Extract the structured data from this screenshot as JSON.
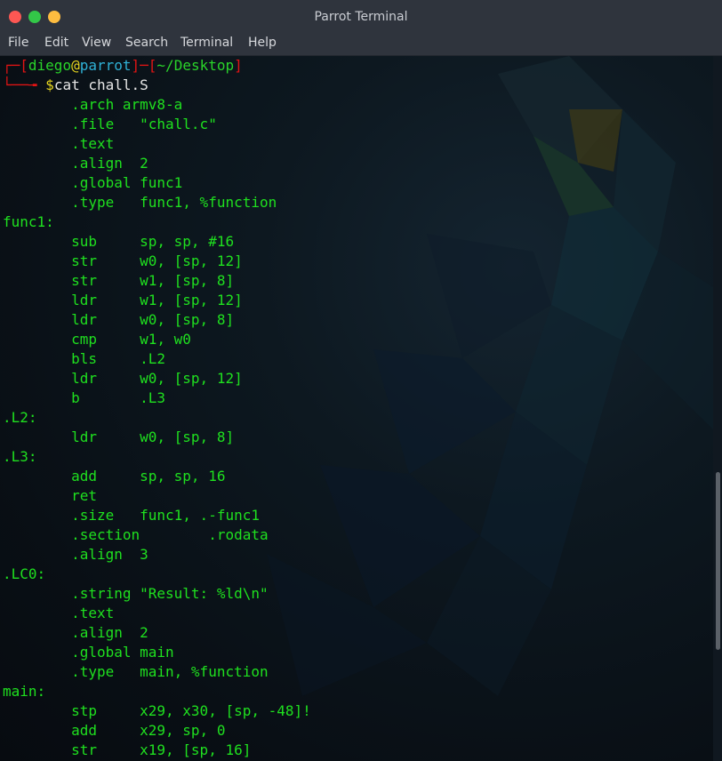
{
  "window": {
    "title": "Parrot Terminal"
  },
  "menu": [
    "File",
    "Edit",
    "View",
    "Search",
    "Terminal",
    "Help"
  ],
  "prompt": {
    "open": "┌─[",
    "user": "diego",
    "at": "@",
    "host": "parrot",
    "sep": "]─[",
    "path": "~/Desktop",
    "close": "]",
    "line2": "└──╼ ",
    "dollar": "$",
    "command": "cat chall.S"
  },
  "lines": [
    "        .arch armv8-a",
    "        .file   \"chall.c\"",
    "        .text",
    "        .align  2",
    "        .global func1",
    "        .type   func1, %function",
    "func1:",
    "        sub     sp, sp, #16",
    "        str     w0, [sp, 12]",
    "        str     w1, [sp, 8]",
    "        ldr     w1, [sp, 12]",
    "        ldr     w0, [sp, 8]",
    "        cmp     w1, w0",
    "        bls     .L2",
    "        ldr     w0, [sp, 12]",
    "        b       .L3",
    ".L2:",
    "        ldr     w0, [sp, 8]",
    ".L3:",
    "        add     sp, sp, 16",
    "        ret",
    "        .size   func1, .-func1",
    "        .section        .rodata",
    "        .align  3",
    ".LC0:",
    "        .string \"Result: %ld\\n\"",
    "        .text",
    "        .align  2",
    "        .global main",
    "        .type   main, %function",
    "main:",
    "        stp     x29, x30, [sp, -48]!",
    "        add     x29, sp, 0",
    "        str     x19, [sp, 16]"
  ]
}
